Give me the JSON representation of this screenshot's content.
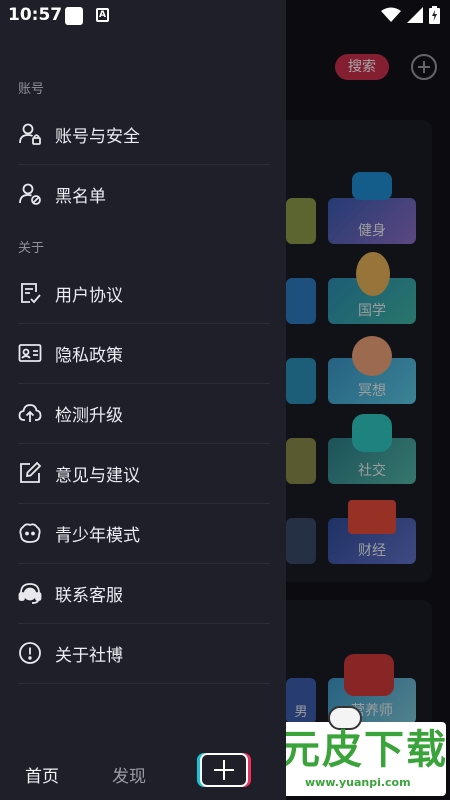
{
  "status_bar": {
    "time": "10:57",
    "notification_icon": "a-square-icon"
  },
  "background": {
    "search_label": "搜索",
    "tiles": [
      {
        "label": "健身"
      },
      {
        "label": "国学"
      },
      {
        "label": "冥想"
      },
      {
        "label": "社交"
      },
      {
        "label": "财经"
      },
      {
        "label": "营养师"
      },
      {
        "label": "男"
      }
    ]
  },
  "drawer": {
    "account_section": "账号",
    "about_section": "关于",
    "items": [
      {
        "label": "账号与安全",
        "icon": "user-lock-icon"
      },
      {
        "label": "黑名单",
        "icon": "user-block-icon"
      },
      {
        "label": "用户协议",
        "icon": "document-check-icon"
      },
      {
        "label": "隐私政策",
        "icon": "id-card-icon"
      },
      {
        "label": "检测升级",
        "icon": "cloud-upload-icon"
      },
      {
        "label": "意见与建议",
        "icon": "edit-icon"
      },
      {
        "label": "青少年模式",
        "icon": "teen-face-icon"
      },
      {
        "label": "联系客服",
        "icon": "headset-icon"
      },
      {
        "label": "关于社博",
        "icon": "info-icon"
      }
    ]
  },
  "bottom_nav": {
    "home": "首页",
    "discover": "发现",
    "add": "plus-icon"
  },
  "watermark": {
    "title": "元皮下载",
    "url": "www.yuanpi.com"
  },
  "colors": {
    "drawer_bg": "#1e1f29",
    "accent_red": "#c9304b",
    "watermark_green": "#3aa33a"
  }
}
